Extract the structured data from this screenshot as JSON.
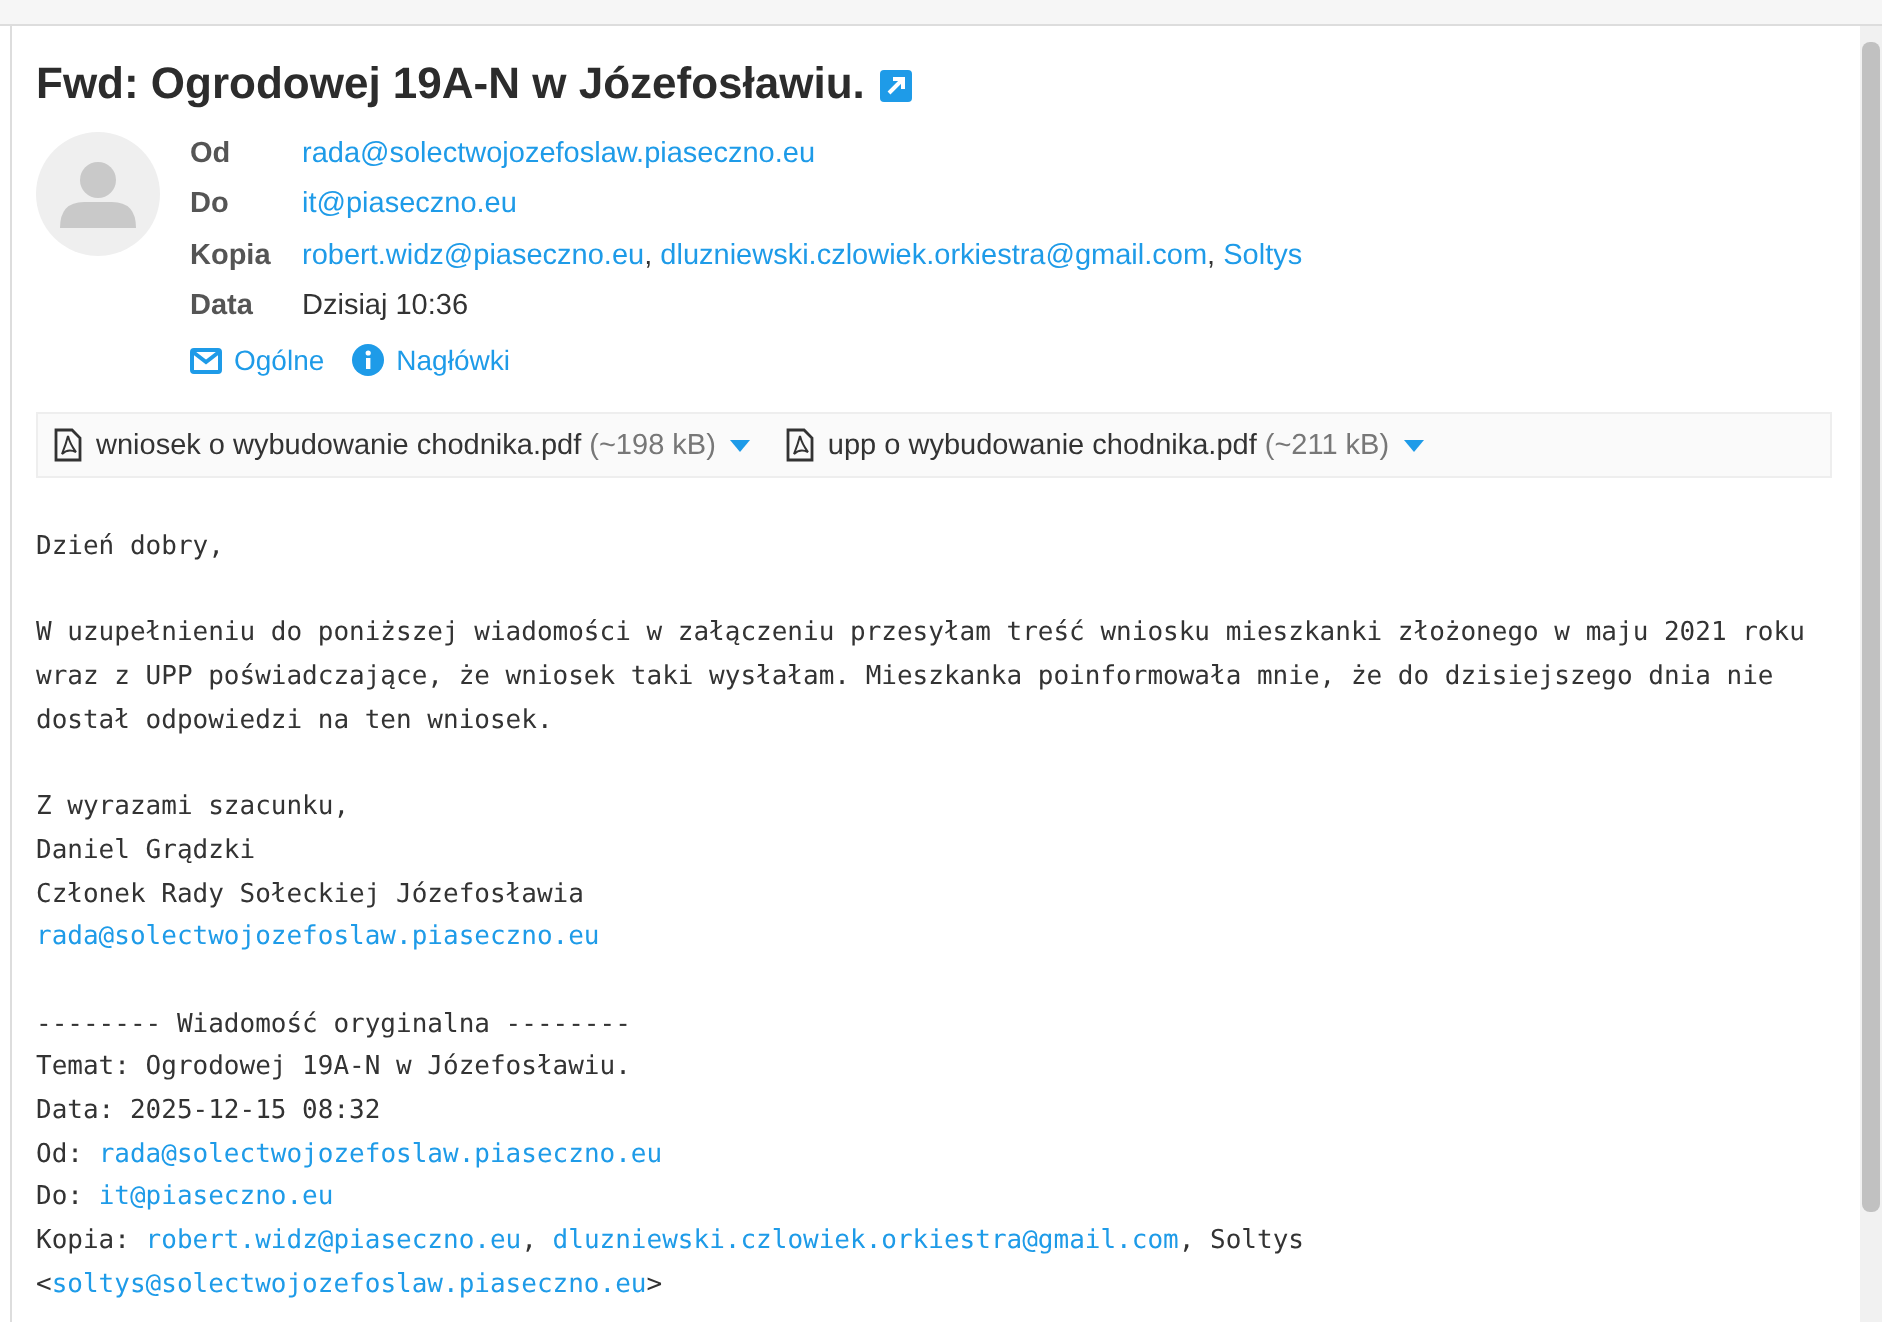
{
  "subject": "Fwd: Ogrodowej 19A-N w Józefosławiu.",
  "headers": [
    {
      "label": "Od",
      "parts": [
        {
          "kind": "link",
          "text": "rada@solectwojozefoslaw.piaseczno.eu"
        }
      ]
    },
    {
      "label": "Do",
      "parts": [
        {
          "kind": "link",
          "text": "it@piaseczno.eu"
        }
      ]
    },
    {
      "label": "Kopia",
      "parts": [
        {
          "kind": "link",
          "text": "robert.widz@piaseczno.eu",
          "suffix": ","
        },
        {
          "kind": "link",
          "text": "dluzniewski.czlowiek.orkiestra@gmail.com",
          "suffix": ","
        },
        {
          "kind": "link",
          "text": "Soltys"
        }
      ]
    },
    {
      "label": "Data",
      "parts": [
        {
          "kind": "text",
          "text": "Dzisiaj 10:36"
        }
      ]
    }
  ],
  "header_links": [
    {
      "kind": "envelope",
      "label": "Ogólne"
    },
    {
      "kind": "info",
      "label": "Nagłówki"
    }
  ],
  "attachments": [
    {
      "name": "wniosek o wybudowanie chodnika.pdf",
      "size": "(~198 kB)"
    },
    {
      "name": "upp o wybudowanie chodnika.pdf",
      "size": "(~211 kB)"
    }
  ],
  "body": [
    [
      [
        {
          "kind": "text",
          "text": "Dzień dobry,"
        }
      ]
    ],
    [
      [
        {
          "kind": "text",
          "text": "W uzupełnieniu do poniższej wiadomości w załączeniu przesyłam treść wniosku mieszkanki złożonego w maju 2021 roku"
        }
      ],
      [
        {
          "kind": "text",
          "text": "wraz z UPP poświadczające, że wniosek taki wysłałam. Mieszkanka poinformowała mnie, że do dzisiejszego dnia nie"
        }
      ],
      [
        {
          "kind": "text",
          "text": "dostał odpowiedzi na ten wniosek."
        }
      ]
    ],
    [
      [
        {
          "kind": "text",
          "text": "Z wyrazami szacunku,"
        }
      ],
      [
        {
          "kind": "text",
          "text": "Daniel Grądzki"
        }
      ],
      [
        {
          "kind": "text",
          "text": "Członek Rady Sołeckiej Józefosławia"
        }
      ],
      [
        {
          "kind": "link",
          "text": "rada@solectwojozefoslaw.piaseczno.eu"
        }
      ]
    ],
    [
      [
        {
          "kind": "text",
          "text": "-------- Wiadomość oryginalna --------"
        }
      ],
      [
        {
          "kind": "text",
          "text": "Temat: Ogrodowej 19A-N w Józefosławiu."
        }
      ],
      [
        {
          "kind": "text",
          "text": "Data: 2025-12-15 08:32"
        }
      ],
      [
        {
          "kind": "text",
          "text": "Od: "
        },
        {
          "kind": "link",
          "text": "rada@solectwojozefoslaw.piaseczno.eu"
        }
      ],
      [
        {
          "kind": "text",
          "text": "Do: "
        },
        {
          "kind": "link",
          "text": "it@piaseczno.eu"
        }
      ],
      [
        {
          "kind": "text",
          "text": "Kopia: "
        },
        {
          "kind": "link",
          "text": "robert.widz@piaseczno.eu"
        },
        {
          "kind": "text",
          "text": ", "
        },
        {
          "kind": "link",
          "text": "dluzniewski.czlowiek.orkiestra@gmail.com"
        },
        {
          "kind": "text",
          "text": ", Soltys"
        }
      ],
      [
        {
          "kind": "text",
          "text": "<"
        },
        {
          "kind": "link",
          "text": "soltys@solectwojozefoslaw.piaseczno.eu"
        },
        {
          "kind": "text",
          "text": ">"
        }
      ]
    ]
  ]
}
